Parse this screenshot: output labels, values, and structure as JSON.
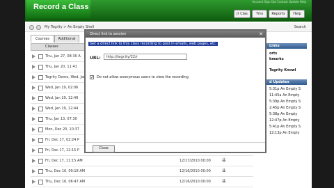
{
  "header": {
    "logo": "Record a Class",
    "account": "Account Sign Out  Contact Update  Help",
    "nav": [
      "Jr Clas",
      "Tms",
      "Reports",
      "Help"
    ]
  },
  "breadcrumb": {
    "text": "My Tegrity > An Empty Shell",
    "search": "Search"
  },
  "tabs": {
    "courses": "Courses",
    "additional": "Additional"
  },
  "table": {
    "header": "Classes"
  },
  "rows": [
    {
      "title": "Thu, Jan 27, 08:30 A",
      "date": "",
      "download": false,
      "checked": false
    },
    {
      "title": "Thu, Jan 20, 11:41",
      "date": "",
      "download": false,
      "checked": false
    },
    {
      "title": "Tegrity Demo, Wed, Jan 19, 01",
      "date": "",
      "download": false,
      "checked": false
    },
    {
      "title": "Wed, Jan 19, 02:06",
      "date": "",
      "download": false,
      "checked": false
    },
    {
      "title": "Wed, Jan 19, 12:49",
      "date": "",
      "download": false,
      "checked": false
    },
    {
      "title": "Wed, Jan 19, 12:44",
      "date": "",
      "download": false,
      "checked": false
    },
    {
      "title": "Thu, Jan 13, 07:30",
      "date": "",
      "download": false,
      "checked": true
    },
    {
      "title": "Mon, Dec 20, 10:37",
      "date": "",
      "download": false,
      "checked": false
    },
    {
      "title": "Fri, Dec 17, 02:24 P",
      "date": "",
      "download": false,
      "checked": false
    },
    {
      "title": "Fri, Dec 17, 12:15 P",
      "date": "",
      "download": false,
      "checked": false
    },
    {
      "title": "Fri, Dec 17, 11:15 AM",
      "date": "12/17/2010 00:00",
      "download": true,
      "checked": false
    },
    {
      "title": "Thu, Dec 16, 09:18 AM",
      "date": "12/16/2010 00:00",
      "download": true,
      "checked": false
    },
    {
      "title": "Thu, Dec 16, 06:47 AM",
      "date": "12/16/2010 00:00",
      "download": true,
      "checked": false
    }
  ],
  "sidebar": {
    "links_header": "Links",
    "links": [
      "orts",
      "kmarks",
      "Tegrity Knowl"
    ],
    "updates_header": "d Updates",
    "updates": [
      "5:31p An Empty S",
      "11:45a An Empty",
      "5:39p An Empty S",
      "2:45p An Empty S",
      "5:38p An Empty",
      "12:47p An Empty",
      "5:41p An Empty S",
      "12:13p An Empty"
    ]
  },
  "modal": {
    "title": "Direct link to session",
    "description": "Get a direct link to this class recording to post in emails, web pages, etc.",
    "url_label": "URL:",
    "url_value": "http://tegr.ity/22/r",
    "checkbox_label": "Do not allow anonymous users to view the recording",
    "checkbox_checked": true,
    "close_label": "Close"
  }
}
